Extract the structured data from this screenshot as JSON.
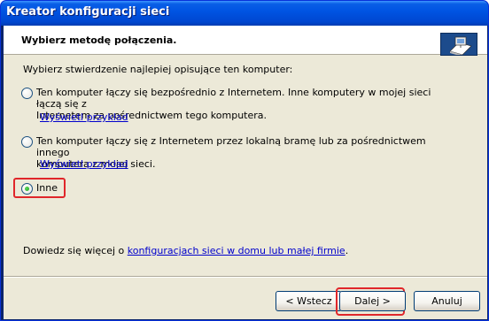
{
  "window": {
    "title": "Kreator konfiguracji sieci"
  },
  "header": {
    "title": "Wybierz metodę połączenia.",
    "icon": "network-computer-icon"
  },
  "content": {
    "intro": "Wybierz stwierdzenie najlepiej opisujące ten komputer:",
    "options": [
      {
        "line1": "Ten komputer łączy się bezpośrednio z Internetem. Inne komputery w mojej sieci łączą się z",
        "line2": "Internetem za pośrednictwem tego komputera.",
        "link": "Wyświetl przykład",
        "selected": false
      },
      {
        "line1": "Ten komputer łączy się z Internetem przez lokalną bramę lub za pośrednictwem innego",
        "line2": "komputera z mojej sieci.",
        "link": "Wyświetl przykład",
        "selected": false
      },
      {
        "line1": "Inne",
        "selected": true
      }
    ],
    "footer_prefix": "Dowiedz się więcej o ",
    "footer_link": "konfiguracjach sieci w domu lub małej firmie",
    "footer_suffix": "."
  },
  "buttons": {
    "back": "< Wstecz",
    "next": "Dalej >",
    "cancel": "Anuluj"
  },
  "colors": {
    "title_blue": "#0054E3",
    "dialog_bg": "#ECE9D8",
    "link": "#0000CC",
    "highlight": "#E0262A"
  }
}
